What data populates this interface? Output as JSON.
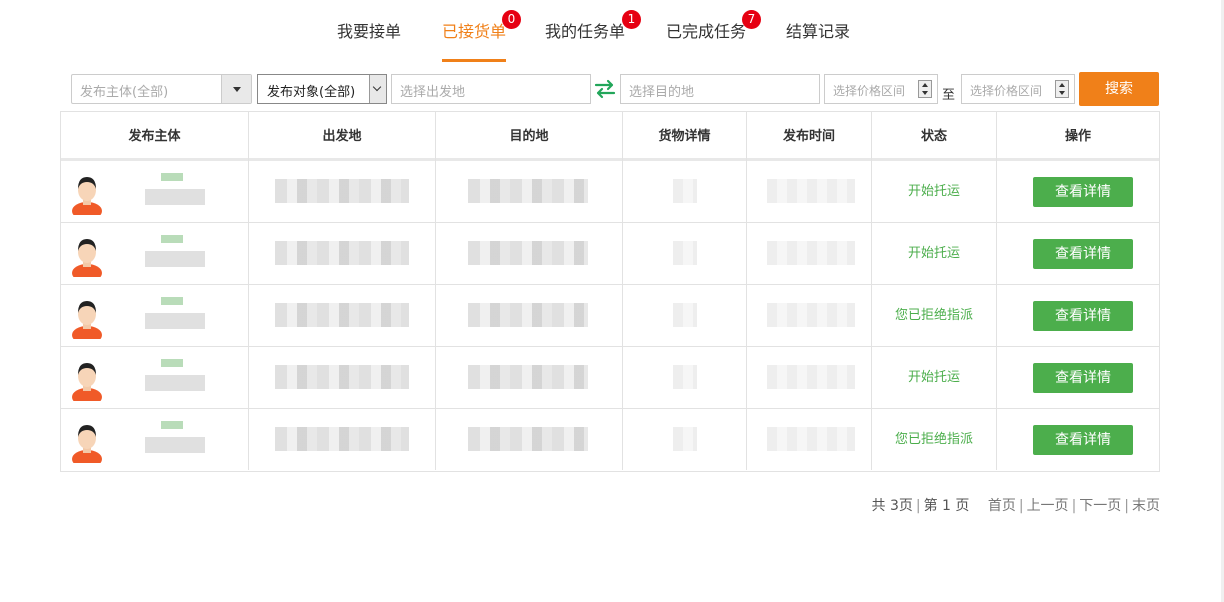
{
  "tabs": [
    {
      "label": "我要接单",
      "badge": null
    },
    {
      "label": "已接货单",
      "badge": "0",
      "active": true
    },
    {
      "label": "我的任务单",
      "badge": "1"
    },
    {
      "label": "已完成任务",
      "badge": "7"
    },
    {
      "label": "结算记录",
      "badge": null
    }
  ],
  "filters": {
    "publisher": "发布主体(全部)",
    "target": "发布对象(全部)",
    "origin_placeholder": "选择出发地",
    "destination_placeholder": "选择目的地",
    "price_min_placeholder": "选择价格区间",
    "price_max_placeholder": "选择价格区间",
    "to_label": "至",
    "search_label": "搜索"
  },
  "table": {
    "headers": [
      "发布主体",
      "出发地",
      "目的地",
      "货物详情",
      "发布时间",
      "状态",
      "操作"
    ],
    "rows": [
      {
        "status": "开始托运",
        "action": "查看详情"
      },
      {
        "status": "开始托运",
        "action": "查看详情"
      },
      {
        "status": "您已拒绝指派",
        "action": "查看详情"
      },
      {
        "status": "开始托运",
        "action": "查看详情"
      },
      {
        "status": "您已拒绝指派",
        "action": "查看详情"
      }
    ]
  },
  "pager": {
    "total_pages": "共 3页",
    "current_page": "第 1 页",
    "first": "首页",
    "prev": "上一页",
    "next": "下一页",
    "last": "末页"
  },
  "colors": {
    "accent": "#f08019",
    "success": "#4cae4c",
    "badge": "#e60012"
  }
}
